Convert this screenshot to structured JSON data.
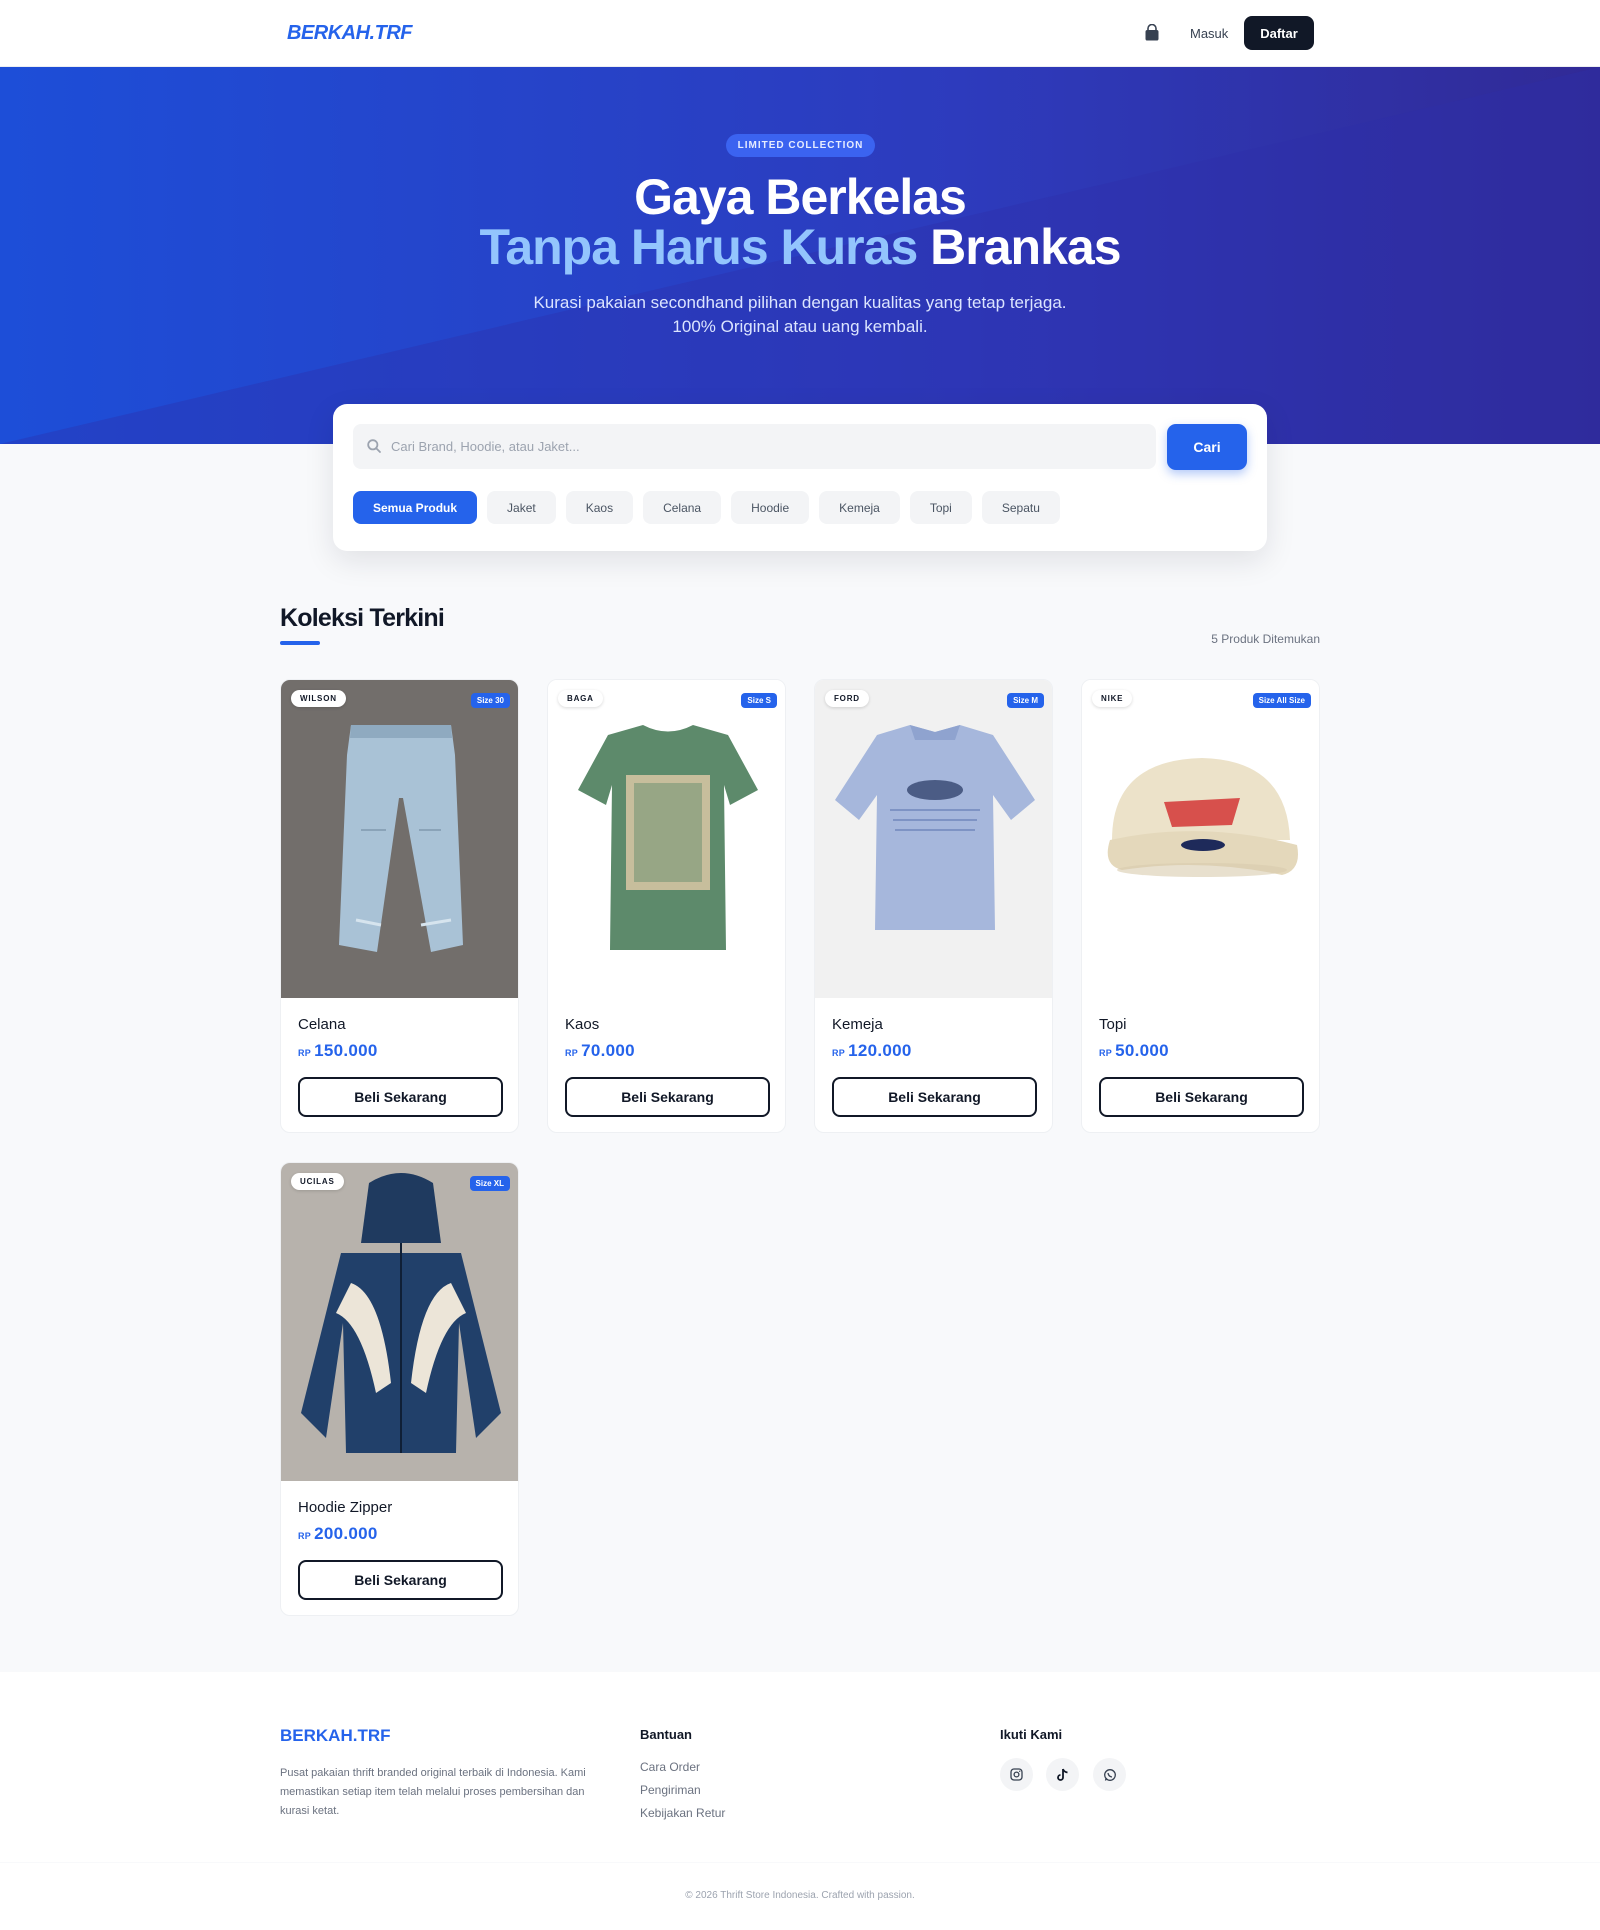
{
  "nav": {
    "logo": "BERKAH.TRF",
    "cart_icon": "shopping-bag-icon",
    "login": "Masuk",
    "register": "Daftar"
  },
  "hero": {
    "badge": "LIMITED COLLECTION",
    "title_line1": "Gaya Berkelas",
    "title_line2_accent": "Tanpa Harus Kuras",
    "title_line2_rest": "Brankas",
    "subtitle_line1": "Kurasi pakaian secondhand pilihan dengan kualitas yang tetap terjaga.",
    "subtitle_line2": "100% Original atau uang kembali."
  },
  "search": {
    "placeholder": "Cari Brand, Hoodie, atau Jaket...",
    "button": "Cari",
    "categories": [
      "Semua Produk",
      "Jaket",
      "Kaos",
      "Celana",
      "Hoodie",
      "Kemeja",
      "Topi",
      "Sepatu"
    ],
    "active_category": "Semua Produk"
  },
  "section": {
    "title": "Koleksi Terkini",
    "count": "5 Produk Ditemukan"
  },
  "products": [
    {
      "brand": "WILSON",
      "size": "Size 30",
      "name": "Celana",
      "currency": "RP",
      "price": "150.000",
      "button": "Beli Sekarang"
    },
    {
      "brand": "BAGA",
      "size": "Size S",
      "name": "Kaos",
      "currency": "RP",
      "price": "70.000",
      "button": "Beli Sekarang"
    },
    {
      "brand": "FORD",
      "size": "Size M",
      "name": "Kemeja",
      "currency": "RP",
      "price": "120.000",
      "button": "Beli Sekarang"
    },
    {
      "brand": "NIKE",
      "size": "Size All Size",
      "name": "Topi",
      "currency": "RP",
      "price": "50.000",
      "button": "Beli Sekarang"
    },
    {
      "brand": "UCILAS",
      "size": "Size XL",
      "name": "Hoodie Zipper",
      "currency": "RP",
      "price": "200.000",
      "button": "Beli Sekarang"
    }
  ],
  "footer": {
    "logo": "BERKAH.TRF",
    "description": "Pusat pakaian thrift branded original terbaik di Indonesia. Kami memastikan setiap item telah melalui proses pembersihan dan kurasi ketat.",
    "help_title": "Bantuan",
    "help_links": [
      "Cara Order",
      "Pengiriman",
      "Kebijakan Retur"
    ],
    "social_title": "Ikuti Kami",
    "social_icons": [
      "instagram-icon",
      "tiktok-icon",
      "whatsapp-icon"
    ],
    "copyright": "© 2026 Thrift Store Indonesia. Crafted with passion."
  },
  "colors": {
    "primary": "#2563eb",
    "dark": "#111827",
    "hero_accent": "#93c5fd"
  }
}
